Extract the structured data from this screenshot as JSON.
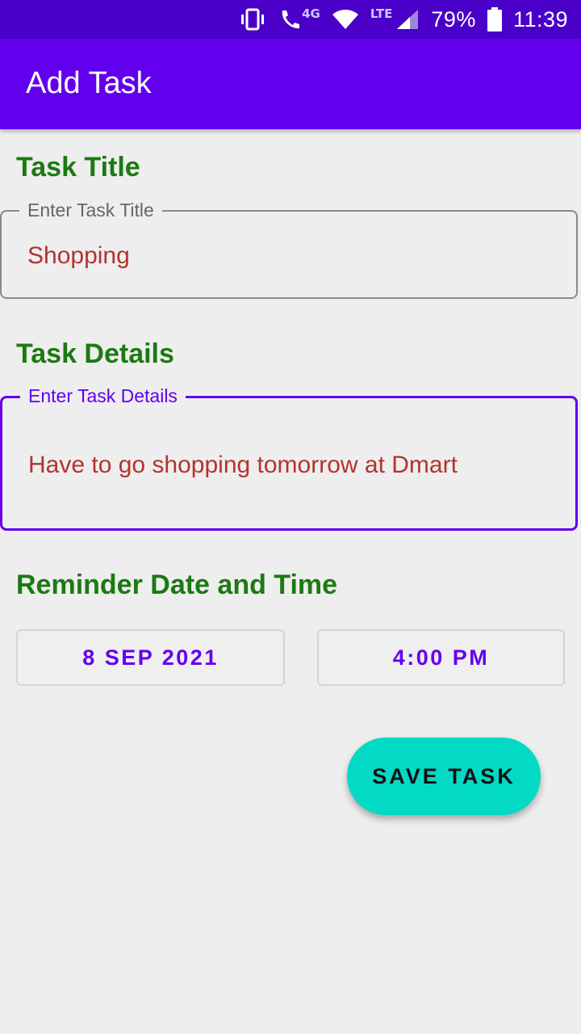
{
  "status_bar": {
    "network": "4G",
    "network_type": "LTE",
    "battery": "79%",
    "time": "11:39",
    "icons": [
      "vibrate-icon",
      "volte-call-icon",
      "wifi-icon",
      "signal-icon",
      "battery-icon"
    ]
  },
  "app_bar": {
    "title": "Add Task"
  },
  "form": {
    "task_title": {
      "heading": "Task Title",
      "label": "Enter Task Title",
      "value": "Shopping"
    },
    "task_details": {
      "heading": "Task Details",
      "label": "Enter Task Details",
      "value": "Have to go shopping tomorrow at Dmart"
    },
    "reminder": {
      "heading": "Reminder Date and Time",
      "date": "8 SEP 2021",
      "time": "4:00 PM"
    },
    "save_label": "SAVE TASK"
  },
  "colors": {
    "status_bar": "#4a00c8",
    "primary": "#6200ee",
    "section_heading": "#1b7a12",
    "input_text": "#b3332e",
    "accent_button": "#03dac5"
  }
}
